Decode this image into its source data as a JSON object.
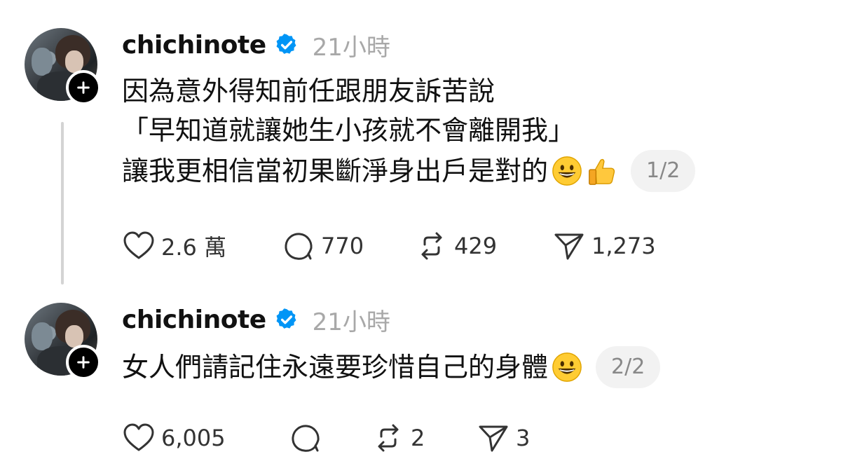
{
  "posts": [
    {
      "username": "chichinote",
      "time": "21小時",
      "lines": [
        "因為意外得知前任跟朋友訴苦說",
        "「早知道就讓她生小孩就不會離開我」",
        "讓我更相信當初果斷淨身出戶是對的"
      ],
      "emojis": [
        "grinning-face-icon",
        "thumbs-up-icon"
      ],
      "page": "1/2",
      "likes": "2.6 萬",
      "replies": "770",
      "reposts": "429",
      "shares": "1,273"
    },
    {
      "username": "chichinote",
      "time": "21小時",
      "lines": [
        "女人們請記住永遠要珍惜自己的身體"
      ],
      "emojis": [
        "grinning-face-icon"
      ],
      "page": "2/2",
      "likes": "6,005",
      "replies": "",
      "reposts": "2",
      "shares": "3"
    }
  ],
  "colors": {
    "verified": "#0095f6",
    "muted": "#a8a8a8",
    "thread_line": "#d4d4d4",
    "pill_bg": "#f2f2f2"
  }
}
